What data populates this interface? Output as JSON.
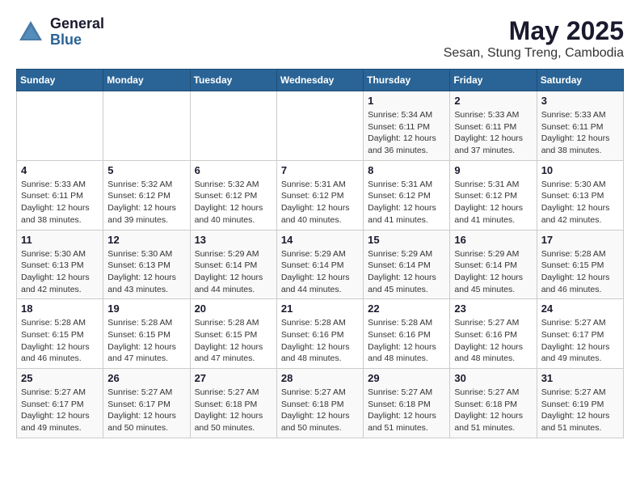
{
  "header": {
    "logo_line1": "General",
    "logo_line2": "Blue",
    "title": "May 2025",
    "subtitle": "Sesan, Stung Treng, Cambodia"
  },
  "calendar": {
    "days_of_week": [
      "Sunday",
      "Monday",
      "Tuesday",
      "Wednesday",
      "Thursday",
      "Friday",
      "Saturday"
    ],
    "weeks": [
      [
        {
          "day": "",
          "info": ""
        },
        {
          "day": "",
          "info": ""
        },
        {
          "day": "",
          "info": ""
        },
        {
          "day": "",
          "info": ""
        },
        {
          "day": "1",
          "info": "Sunrise: 5:34 AM\nSunset: 6:11 PM\nDaylight: 12 hours\nand 36 minutes."
        },
        {
          "day": "2",
          "info": "Sunrise: 5:33 AM\nSunset: 6:11 PM\nDaylight: 12 hours\nand 37 minutes."
        },
        {
          "day": "3",
          "info": "Sunrise: 5:33 AM\nSunset: 6:11 PM\nDaylight: 12 hours\nand 38 minutes."
        }
      ],
      [
        {
          "day": "4",
          "info": "Sunrise: 5:33 AM\nSunset: 6:11 PM\nDaylight: 12 hours\nand 38 minutes."
        },
        {
          "day": "5",
          "info": "Sunrise: 5:32 AM\nSunset: 6:12 PM\nDaylight: 12 hours\nand 39 minutes."
        },
        {
          "day": "6",
          "info": "Sunrise: 5:32 AM\nSunset: 6:12 PM\nDaylight: 12 hours\nand 40 minutes."
        },
        {
          "day": "7",
          "info": "Sunrise: 5:31 AM\nSunset: 6:12 PM\nDaylight: 12 hours\nand 40 minutes."
        },
        {
          "day": "8",
          "info": "Sunrise: 5:31 AM\nSunset: 6:12 PM\nDaylight: 12 hours\nand 41 minutes."
        },
        {
          "day": "9",
          "info": "Sunrise: 5:31 AM\nSunset: 6:12 PM\nDaylight: 12 hours\nand 41 minutes."
        },
        {
          "day": "10",
          "info": "Sunrise: 5:30 AM\nSunset: 6:13 PM\nDaylight: 12 hours\nand 42 minutes."
        }
      ],
      [
        {
          "day": "11",
          "info": "Sunrise: 5:30 AM\nSunset: 6:13 PM\nDaylight: 12 hours\nand 42 minutes."
        },
        {
          "day": "12",
          "info": "Sunrise: 5:30 AM\nSunset: 6:13 PM\nDaylight: 12 hours\nand 43 minutes."
        },
        {
          "day": "13",
          "info": "Sunrise: 5:29 AM\nSunset: 6:14 PM\nDaylight: 12 hours\nand 44 minutes."
        },
        {
          "day": "14",
          "info": "Sunrise: 5:29 AM\nSunset: 6:14 PM\nDaylight: 12 hours\nand 44 minutes."
        },
        {
          "day": "15",
          "info": "Sunrise: 5:29 AM\nSunset: 6:14 PM\nDaylight: 12 hours\nand 45 minutes."
        },
        {
          "day": "16",
          "info": "Sunrise: 5:29 AM\nSunset: 6:14 PM\nDaylight: 12 hours\nand 45 minutes."
        },
        {
          "day": "17",
          "info": "Sunrise: 5:28 AM\nSunset: 6:15 PM\nDaylight: 12 hours\nand 46 minutes."
        }
      ],
      [
        {
          "day": "18",
          "info": "Sunrise: 5:28 AM\nSunset: 6:15 PM\nDaylight: 12 hours\nand 46 minutes."
        },
        {
          "day": "19",
          "info": "Sunrise: 5:28 AM\nSunset: 6:15 PM\nDaylight: 12 hours\nand 47 minutes."
        },
        {
          "day": "20",
          "info": "Sunrise: 5:28 AM\nSunset: 6:15 PM\nDaylight: 12 hours\nand 47 minutes."
        },
        {
          "day": "21",
          "info": "Sunrise: 5:28 AM\nSunset: 6:16 PM\nDaylight: 12 hours\nand 48 minutes."
        },
        {
          "day": "22",
          "info": "Sunrise: 5:28 AM\nSunset: 6:16 PM\nDaylight: 12 hours\nand 48 minutes."
        },
        {
          "day": "23",
          "info": "Sunrise: 5:27 AM\nSunset: 6:16 PM\nDaylight: 12 hours\nand 48 minutes."
        },
        {
          "day": "24",
          "info": "Sunrise: 5:27 AM\nSunset: 6:17 PM\nDaylight: 12 hours\nand 49 minutes."
        }
      ],
      [
        {
          "day": "25",
          "info": "Sunrise: 5:27 AM\nSunset: 6:17 PM\nDaylight: 12 hours\nand 49 minutes."
        },
        {
          "day": "26",
          "info": "Sunrise: 5:27 AM\nSunset: 6:17 PM\nDaylight: 12 hours\nand 50 minutes."
        },
        {
          "day": "27",
          "info": "Sunrise: 5:27 AM\nSunset: 6:18 PM\nDaylight: 12 hours\nand 50 minutes."
        },
        {
          "day": "28",
          "info": "Sunrise: 5:27 AM\nSunset: 6:18 PM\nDaylight: 12 hours\nand 50 minutes."
        },
        {
          "day": "29",
          "info": "Sunrise: 5:27 AM\nSunset: 6:18 PM\nDaylight: 12 hours\nand 51 minutes."
        },
        {
          "day": "30",
          "info": "Sunrise: 5:27 AM\nSunset: 6:18 PM\nDaylight: 12 hours\nand 51 minutes."
        },
        {
          "day": "31",
          "info": "Sunrise: 5:27 AM\nSunset: 6:19 PM\nDaylight: 12 hours\nand 51 minutes."
        }
      ]
    ]
  }
}
